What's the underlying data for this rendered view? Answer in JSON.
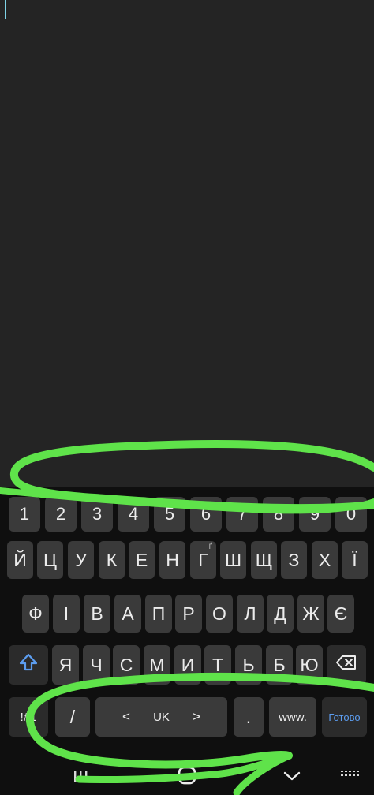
{
  "colors": {
    "text_area_bg": "#242424",
    "keyboard_bg": "#0f0f0f",
    "key_bg": "#3a3a3a",
    "key_text": "#ececec",
    "accent_blue": "#5c9df0",
    "highlight_marker": "#5fe34a"
  },
  "keyboard": {
    "number_row": [
      "1",
      "2",
      "3",
      "4",
      "5",
      "6",
      "7",
      "8",
      "9",
      "0"
    ],
    "row1": [
      "Й",
      "Ц",
      "У",
      "К",
      "Е",
      "Н",
      "Г",
      "Ш",
      "Щ",
      "З",
      "Х",
      "Ї"
    ],
    "row2": [
      "Ф",
      "І",
      "В",
      "А",
      "П",
      "Р",
      "О",
      "Л",
      "Д",
      "Ж",
      "Є"
    ],
    "row3": [
      "Я",
      "Ч",
      "С",
      "М",
      "И",
      "Т",
      "Ь",
      "Б",
      "Ю"
    ],
    "row1_hint": "Ґ",
    "shift_icon": "shift-arrow-icon",
    "backspace_icon": "backspace-icon",
    "bottom": {
      "symbols": "!#1",
      "slash": "/",
      "space_left": "<",
      "language": "UK",
      "space_right": ">",
      "period": ".",
      "www": "www.",
      "done": "Готово"
    }
  },
  "navbar": {
    "recents_icon": "recent-apps-icon",
    "home_icon": "home-icon",
    "back_icon": "hide-keyboard-chevron-icon",
    "keyboard_icon": "keyboard-switch-icon"
  }
}
